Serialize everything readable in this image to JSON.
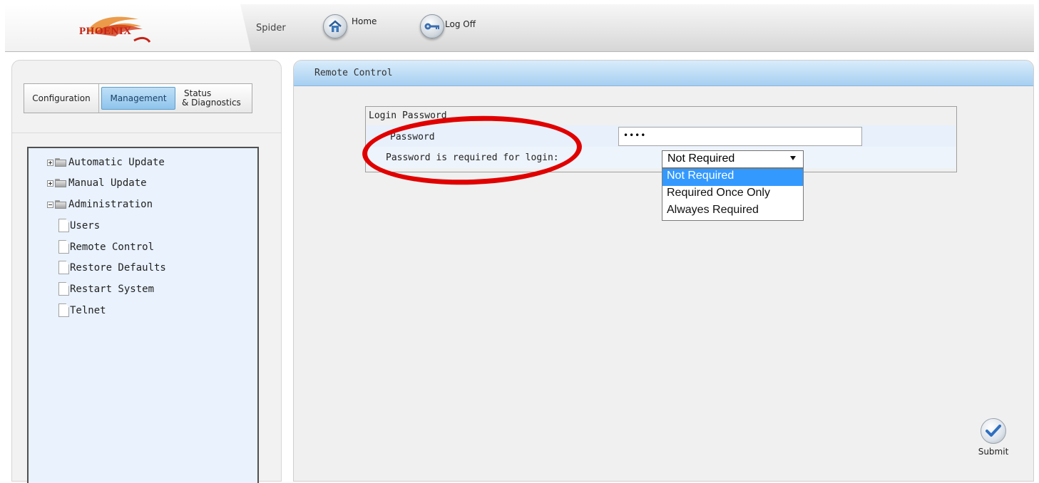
{
  "header": {
    "logo_text": "PHOENIX",
    "device_name": "Spider",
    "nav": [
      {
        "label": "Home",
        "icon": "home-icon"
      },
      {
        "label": "Log Off",
        "icon": "key-icon"
      }
    ]
  },
  "sidebar": {
    "tabs": [
      {
        "label": "Configuration",
        "selected": false
      },
      {
        "label": "Management",
        "selected": true
      },
      {
        "label": "Status",
        "label2": "& Diagnostics",
        "selected": false
      }
    ],
    "tree": [
      {
        "label": "Automatic Update",
        "type": "folder",
        "expanded": false
      },
      {
        "label": "Manual Update",
        "type": "folder",
        "expanded": false
      },
      {
        "label": "Administration",
        "type": "folder",
        "expanded": true
      },
      {
        "label": "Users",
        "type": "page"
      },
      {
        "label": "Remote Control",
        "type": "page"
      },
      {
        "label": "Restore Defaults",
        "type": "page"
      },
      {
        "label": "Restart System",
        "type": "page"
      },
      {
        "label": "Telnet",
        "type": "page"
      }
    ]
  },
  "main": {
    "title": "Remote Control",
    "section_title": "Login Password",
    "password_label": "Password",
    "password_value": "••••",
    "required_label": "Password is required for login:",
    "required_select": {
      "value": "Not Required",
      "options": [
        "Not Required",
        "Required Once Only",
        "Alwayes Required"
      ],
      "highlighted_index": 0
    },
    "submit_label": "Submit"
  },
  "colors": {
    "annotation": "#e00000",
    "option_highlight": "#3399ff",
    "logo": "#c42418"
  }
}
